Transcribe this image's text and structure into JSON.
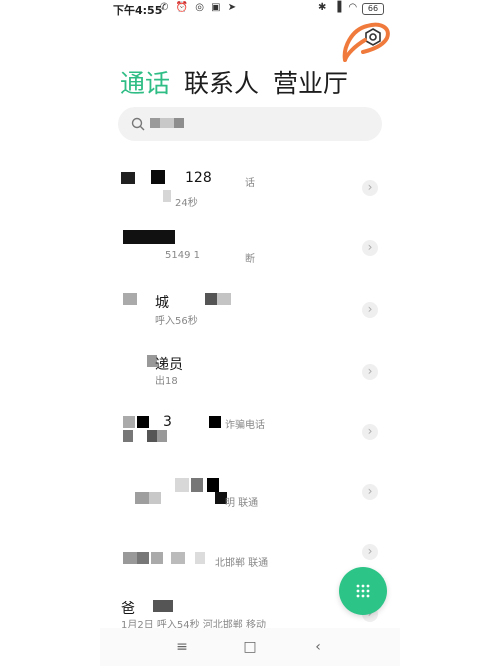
{
  "status_bar": {
    "time": "下午4:55",
    "battery": "66"
  },
  "tabs": [
    {
      "label": "通话",
      "active": true
    },
    {
      "label": "联系人",
      "active": false
    },
    {
      "label": "营业厅",
      "active": false
    }
  ],
  "colors": {
    "accent": "#2fbd85",
    "fab": "#2dc487",
    "annotation": "#f07a3c"
  },
  "calls": [
    {
      "name": "128",
      "sub": "24秒",
      "loc": "话"
    },
    {
      "name": "",
      "sub": "5149 1",
      "loc": "断"
    },
    {
      "name": "城",
      "sub": "呼入56秒",
      "loc": ""
    },
    {
      "name": "递员",
      "sub": "出18",
      "loc": ""
    },
    {
      "name": "3",
      "sub": "",
      "loc": "诈骗电话"
    },
    {
      "name": "",
      "sub": "",
      "loc": "明 联通"
    },
    {
      "name": "",
      "sub": "",
      "loc": "北邯郸 联通"
    },
    {
      "name": "爸",
      "sub": "1月2日 呼入54秒 河北邯郸 移动",
      "loc": ""
    }
  ]
}
